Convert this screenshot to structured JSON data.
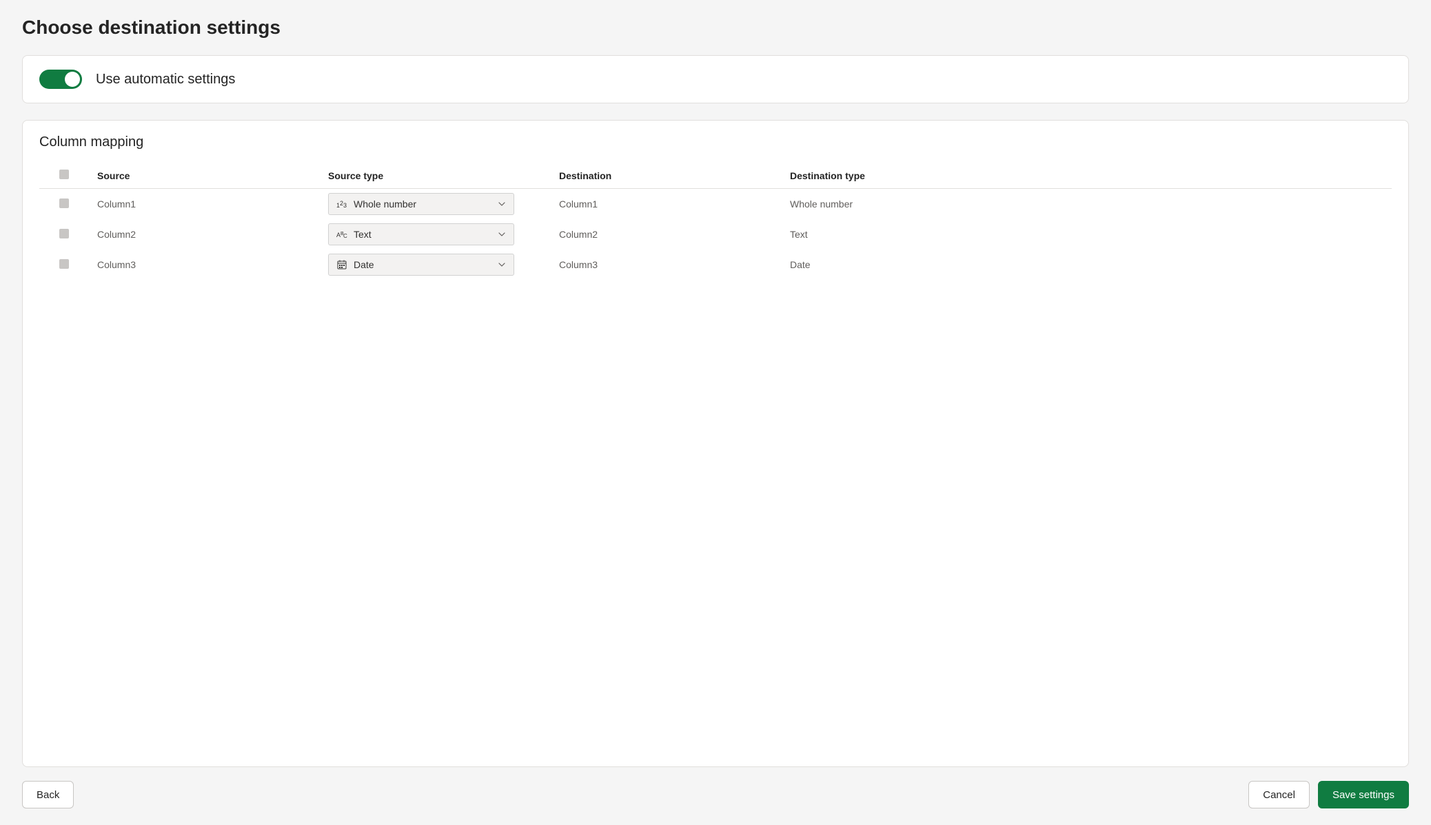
{
  "page": {
    "title": "Choose destination settings"
  },
  "autoSettings": {
    "label": "Use automatic settings",
    "enabled": true
  },
  "mapping": {
    "title": "Column mapping",
    "headers": {
      "source": "Source",
      "sourceType": "Source type",
      "destination": "Destination",
      "destinationType": "Destination type"
    },
    "rows": [
      {
        "source": "Column1",
        "sourceType": "Whole number",
        "sourceTypeIcon": "number-icon",
        "destination": "Column1",
        "destinationType": "Whole number"
      },
      {
        "source": "Column2",
        "sourceType": "Text",
        "sourceTypeIcon": "text-icon",
        "destination": "Column2",
        "destinationType": "Text"
      },
      {
        "source": "Column3",
        "sourceType": "Date",
        "sourceTypeIcon": "calendar-icon",
        "destination": "Column3",
        "destinationType": "Date"
      }
    ]
  },
  "footer": {
    "back": "Back",
    "cancel": "Cancel",
    "save": "Save settings"
  }
}
